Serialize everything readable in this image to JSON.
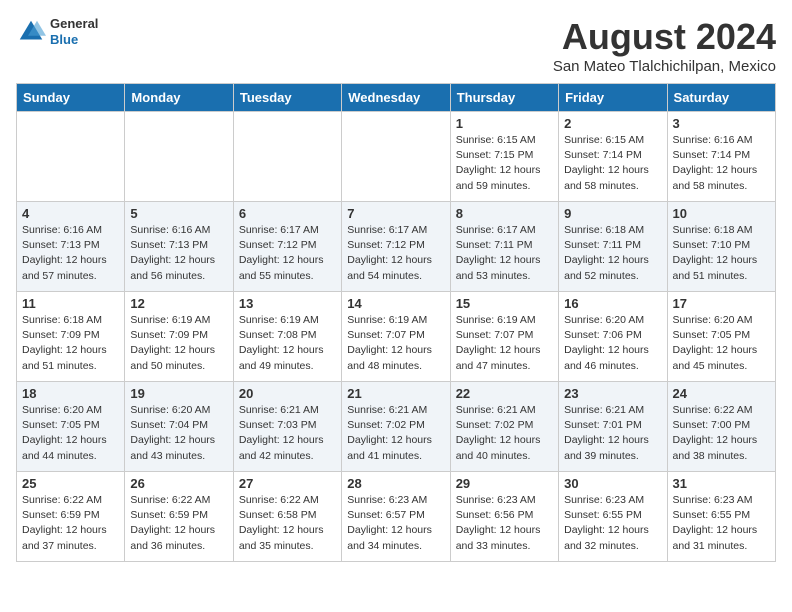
{
  "header": {
    "logo_general": "General",
    "logo_blue": "Blue",
    "title": "August 2024",
    "subtitle": "San Mateo Tlalchichilpan, Mexico"
  },
  "days_of_week": [
    "Sunday",
    "Monday",
    "Tuesday",
    "Wednesday",
    "Thursday",
    "Friday",
    "Saturday"
  ],
  "weeks": [
    [
      {
        "day": "",
        "info": ""
      },
      {
        "day": "",
        "info": ""
      },
      {
        "day": "",
        "info": ""
      },
      {
        "day": "",
        "info": ""
      },
      {
        "day": "1",
        "info": "Sunrise: 6:15 AM\nSunset: 7:15 PM\nDaylight: 12 hours\nand 59 minutes."
      },
      {
        "day": "2",
        "info": "Sunrise: 6:15 AM\nSunset: 7:14 PM\nDaylight: 12 hours\nand 58 minutes."
      },
      {
        "day": "3",
        "info": "Sunrise: 6:16 AM\nSunset: 7:14 PM\nDaylight: 12 hours\nand 58 minutes."
      }
    ],
    [
      {
        "day": "4",
        "info": "Sunrise: 6:16 AM\nSunset: 7:13 PM\nDaylight: 12 hours\nand 57 minutes."
      },
      {
        "day": "5",
        "info": "Sunrise: 6:16 AM\nSunset: 7:13 PM\nDaylight: 12 hours\nand 56 minutes."
      },
      {
        "day": "6",
        "info": "Sunrise: 6:17 AM\nSunset: 7:12 PM\nDaylight: 12 hours\nand 55 minutes."
      },
      {
        "day": "7",
        "info": "Sunrise: 6:17 AM\nSunset: 7:12 PM\nDaylight: 12 hours\nand 54 minutes."
      },
      {
        "day": "8",
        "info": "Sunrise: 6:17 AM\nSunset: 7:11 PM\nDaylight: 12 hours\nand 53 minutes."
      },
      {
        "day": "9",
        "info": "Sunrise: 6:18 AM\nSunset: 7:11 PM\nDaylight: 12 hours\nand 52 minutes."
      },
      {
        "day": "10",
        "info": "Sunrise: 6:18 AM\nSunset: 7:10 PM\nDaylight: 12 hours\nand 51 minutes."
      }
    ],
    [
      {
        "day": "11",
        "info": "Sunrise: 6:18 AM\nSunset: 7:09 PM\nDaylight: 12 hours\nand 51 minutes."
      },
      {
        "day": "12",
        "info": "Sunrise: 6:19 AM\nSunset: 7:09 PM\nDaylight: 12 hours\nand 50 minutes."
      },
      {
        "day": "13",
        "info": "Sunrise: 6:19 AM\nSunset: 7:08 PM\nDaylight: 12 hours\nand 49 minutes."
      },
      {
        "day": "14",
        "info": "Sunrise: 6:19 AM\nSunset: 7:07 PM\nDaylight: 12 hours\nand 48 minutes."
      },
      {
        "day": "15",
        "info": "Sunrise: 6:19 AM\nSunset: 7:07 PM\nDaylight: 12 hours\nand 47 minutes."
      },
      {
        "day": "16",
        "info": "Sunrise: 6:20 AM\nSunset: 7:06 PM\nDaylight: 12 hours\nand 46 minutes."
      },
      {
        "day": "17",
        "info": "Sunrise: 6:20 AM\nSunset: 7:05 PM\nDaylight: 12 hours\nand 45 minutes."
      }
    ],
    [
      {
        "day": "18",
        "info": "Sunrise: 6:20 AM\nSunset: 7:05 PM\nDaylight: 12 hours\nand 44 minutes."
      },
      {
        "day": "19",
        "info": "Sunrise: 6:20 AM\nSunset: 7:04 PM\nDaylight: 12 hours\nand 43 minutes."
      },
      {
        "day": "20",
        "info": "Sunrise: 6:21 AM\nSunset: 7:03 PM\nDaylight: 12 hours\nand 42 minutes."
      },
      {
        "day": "21",
        "info": "Sunrise: 6:21 AM\nSunset: 7:02 PM\nDaylight: 12 hours\nand 41 minutes."
      },
      {
        "day": "22",
        "info": "Sunrise: 6:21 AM\nSunset: 7:02 PM\nDaylight: 12 hours\nand 40 minutes."
      },
      {
        "day": "23",
        "info": "Sunrise: 6:21 AM\nSunset: 7:01 PM\nDaylight: 12 hours\nand 39 minutes."
      },
      {
        "day": "24",
        "info": "Sunrise: 6:22 AM\nSunset: 7:00 PM\nDaylight: 12 hours\nand 38 minutes."
      }
    ],
    [
      {
        "day": "25",
        "info": "Sunrise: 6:22 AM\nSunset: 6:59 PM\nDaylight: 12 hours\nand 37 minutes."
      },
      {
        "day": "26",
        "info": "Sunrise: 6:22 AM\nSunset: 6:59 PM\nDaylight: 12 hours\nand 36 minutes."
      },
      {
        "day": "27",
        "info": "Sunrise: 6:22 AM\nSunset: 6:58 PM\nDaylight: 12 hours\nand 35 minutes."
      },
      {
        "day": "28",
        "info": "Sunrise: 6:23 AM\nSunset: 6:57 PM\nDaylight: 12 hours\nand 34 minutes."
      },
      {
        "day": "29",
        "info": "Sunrise: 6:23 AM\nSunset: 6:56 PM\nDaylight: 12 hours\nand 33 minutes."
      },
      {
        "day": "30",
        "info": "Sunrise: 6:23 AM\nSunset: 6:55 PM\nDaylight: 12 hours\nand 32 minutes."
      },
      {
        "day": "31",
        "info": "Sunrise: 6:23 AM\nSunset: 6:55 PM\nDaylight: 12 hours\nand 31 minutes."
      }
    ]
  ]
}
